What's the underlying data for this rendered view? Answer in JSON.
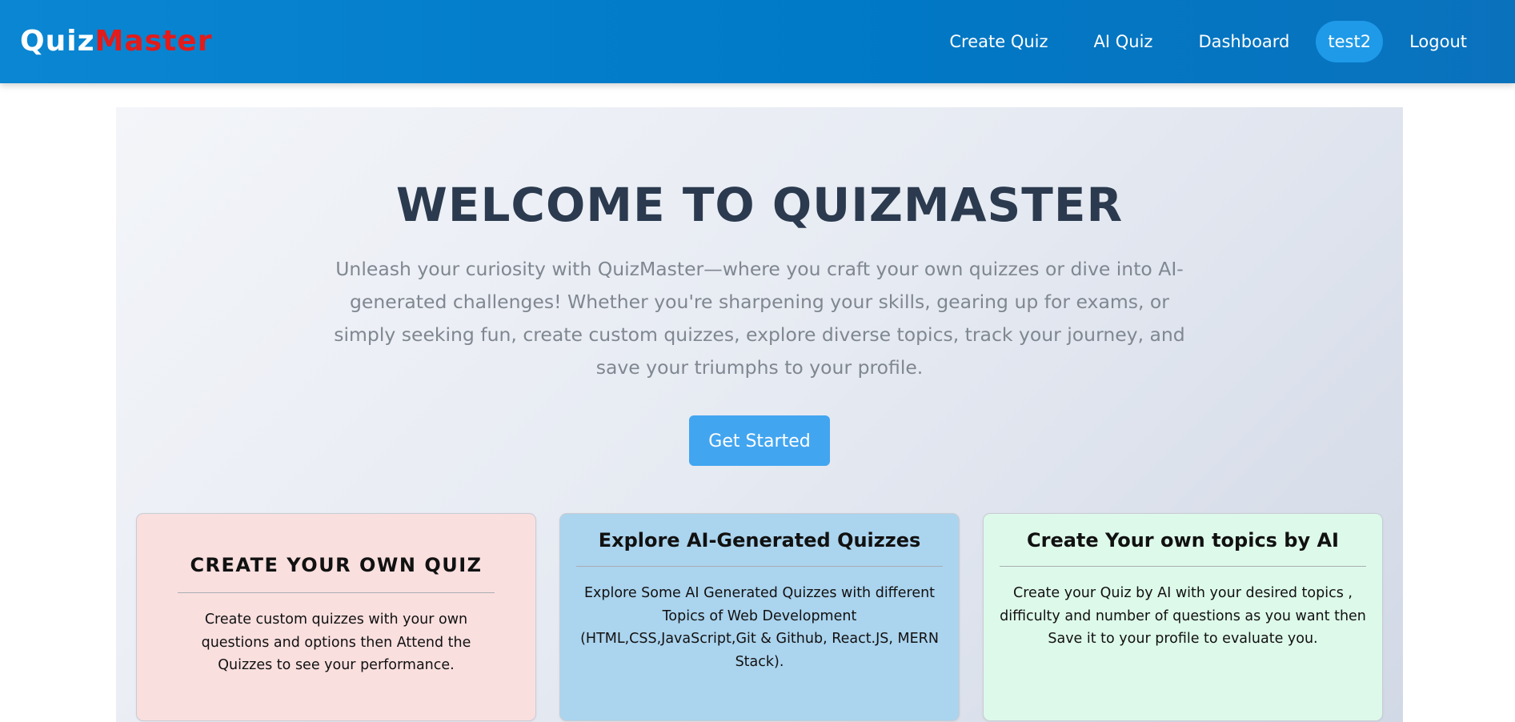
{
  "navbar": {
    "brand_part1": "Quiz",
    "brand_part2": "Master",
    "links": {
      "create_quiz": "Create Quiz",
      "ai_quiz": "AI Quiz",
      "dashboard": "Dashboard",
      "user": "test2",
      "logout": "Logout"
    }
  },
  "hero": {
    "title": "WELCOME TO QUIZMASTER",
    "description": "Unleash your curiosity with QuizMaster—where you craft your own quizzes or dive into AI-generated challenges! Whether you're sharpening your skills, gearing up for exams, or simply seeking fun, create custom quizzes, explore diverse topics, track your journey, and save your triumphs to your profile.",
    "cta_label": "Get Started"
  },
  "cards": [
    {
      "title": "CREATE YOUR OWN QUIZ",
      "text": "Create custom quizzes with your own questions and options then Attend the Quizzes to see your performance."
    },
    {
      "title": "Explore AI-Generated Quizzes",
      "text": "Explore Some AI Generated Quizzes with different Topics of Web Development (HTML,CSS,JavaScript,Git & Github, React.JS, MERN Stack)."
    },
    {
      "title": "Create Your own topics by AI",
      "text": "Create your Quiz by AI with your desired topics , difficulty and number of questions as you want then Save it to your profile to evaluate you."
    }
  ],
  "colors": {
    "navbar": "#0079c6",
    "brand_accent": "#e21b1b",
    "cta": "#42a5f0",
    "card_1": "#fadfdf",
    "card_2": "#abd4ee",
    "card_3": "#ddf9ea"
  }
}
